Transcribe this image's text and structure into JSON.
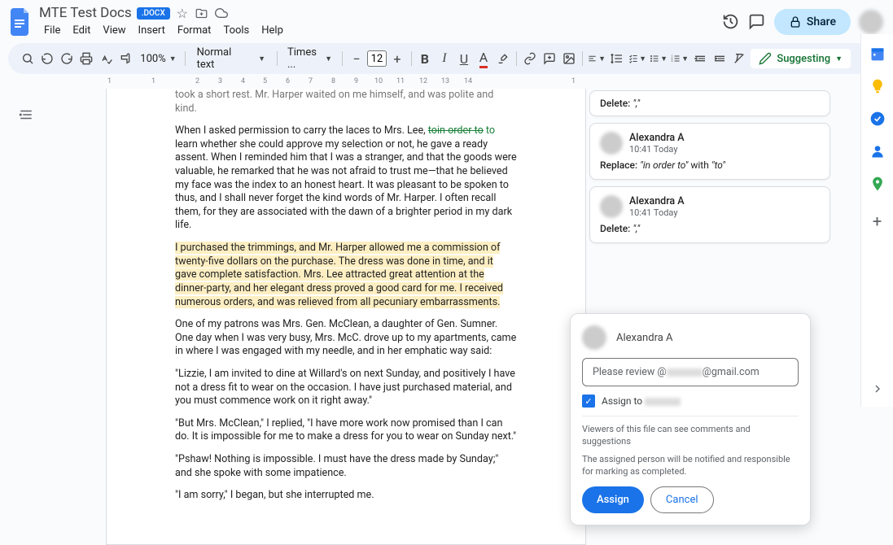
{
  "header": {
    "title": "MTE Test Docs",
    "badge": ".DOCX",
    "menu": [
      "File",
      "Edit",
      "View",
      "Insert",
      "Format",
      "Tools",
      "Help"
    ],
    "share": "Share"
  },
  "toolbar": {
    "zoom": "100%",
    "style": "Normal text",
    "font": "Times ...",
    "size": "12",
    "mode": "Suggesting"
  },
  "ruler": {
    "marks": [
      "1",
      "1",
      "2",
      "3",
      "4",
      "5",
      "6",
      "7",
      "8",
      "9",
      "10",
      "11",
      "12",
      "13",
      "14",
      "1"
    ]
  },
  "doc": {
    "p0": "took a short rest. Mr. Harper waited on me himself, and was polite and kind.",
    "p1a": "When I asked permission to carry the laces to Mrs. Lee, ",
    "p1strike": "toin order to",
    "p1insert": " to ",
    "p1b": "learn whether she could approve my selection or not, he gave a ready assent. When I reminded him that I was a stranger, and that the goods were valuable, he remarked that he was not afraid to trust me—that he believed my face was the index to an honest heart. It was pleasant to be spoken to thus, and I shall never forget the kind words of Mr. Harper. I often recall them, for they are associated with the dawn of a brighter period in my dark life.",
    "p2": "I purchased the trimmings, and Mr. Harper allowed me a commission of twenty-five dollars on the purchase. The dress was done in time, and it gave complete satisfaction. Mrs. Lee attracted great attention at the dinner-party, and her elegant dress proved a good card for me. I received numerous orders, and was relieved from all pecuniary embarrassments.",
    "p3": "One of my patrons was Mrs. Gen. McClean, a daughter of Gen. Sumner. One day when I was very busy, Mrs. McC. drove up to my apartments, came in where I was engaged with my needle, and in her emphatic way said:",
    "p4": "\"Lizzie, I am invited to dine at Willard's on next Sunday, and positively I have not a dress fit to wear on the occasion. I have just purchased material, and you must commence work on it right away.\"",
    "p5": "\"But Mrs. McClean,\" I replied, \"I have more work now promised than I can do. It is impossible for me to make a dress for you to wear on Sunday next.\"",
    "p6": "\"Pshaw! Nothing is impossible. I must have the dress made by Sunday;\" and she spoke with some impatience.",
    "p7": "\"I am sorry,\" I began, but she interrupted me."
  },
  "comments": {
    "c0": {
      "action": "Delete:",
      "text": "\",\""
    },
    "c1": {
      "name": "Alexandra A",
      "time": "10:41 Today",
      "action": "Replace:",
      "from": "\"in order to\"",
      "with": "with",
      "to": "\"to\""
    },
    "c2": {
      "name": "Alexandra A",
      "time": "10:41 Today",
      "action": "Delete:",
      "text": "\",\""
    }
  },
  "assign": {
    "name": "Alexandra A",
    "input": "Please review @",
    "input_suffix": "@gmail.com",
    "check_prefix": "Assign to ",
    "note1": "Viewers of this file can see comments and suggestions",
    "note2": "The assigned person will be notified and responsible for marking as completed.",
    "assign_btn": "Assign",
    "cancel_btn": "Cancel"
  }
}
